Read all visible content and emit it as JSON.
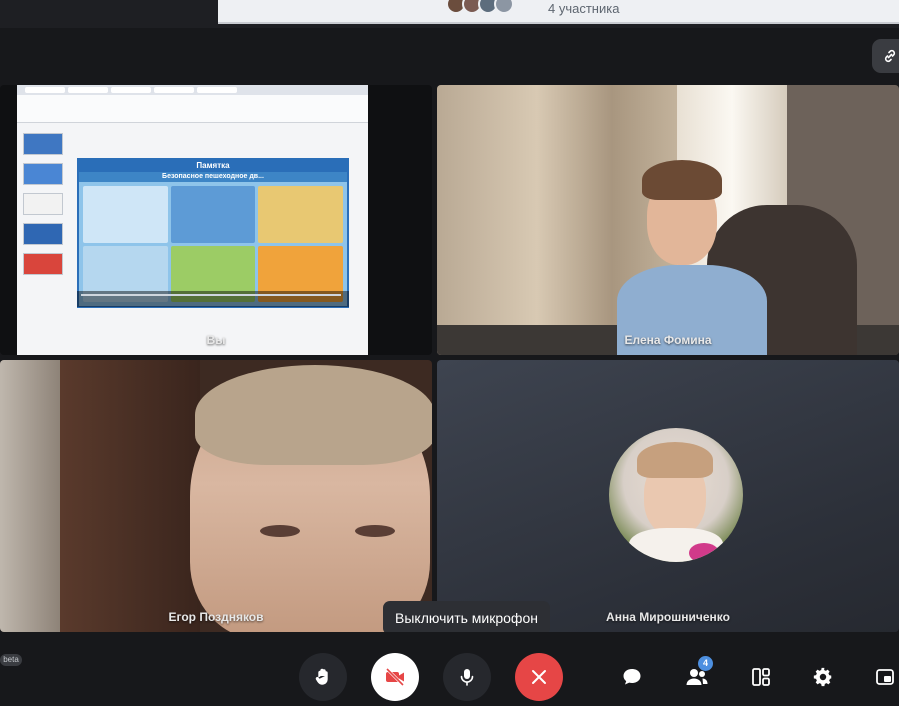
{
  "header": {
    "participants_text": "4 участника"
  },
  "tiles": [
    {
      "name": "Вы",
      "type": "screen-share"
    },
    {
      "name": "Елена Фомина",
      "type": "camera"
    },
    {
      "name": "Егор Поздняков",
      "type": "camera"
    },
    {
      "name": "Анна Мирошниченко",
      "type": "avatar"
    }
  ],
  "shared_screen": {
    "slide_title": "Памятка",
    "slide_subtitle": "Безопасное пешеходное дв..."
  },
  "tooltip": {
    "text": "Выключить микрофон"
  },
  "controls": {
    "beta_label": "beta",
    "participants_badge": "4"
  },
  "colors": {
    "end_call": "#e64646",
    "badge": "#4d8fe0",
    "background": "#17181b"
  },
  "icons": [
    "link-icon",
    "raise-hand-icon",
    "camera-off-icon",
    "microphone-icon",
    "close-icon",
    "chat-icon",
    "participants-icon",
    "layout-icon",
    "gear-icon",
    "pip-icon"
  ]
}
